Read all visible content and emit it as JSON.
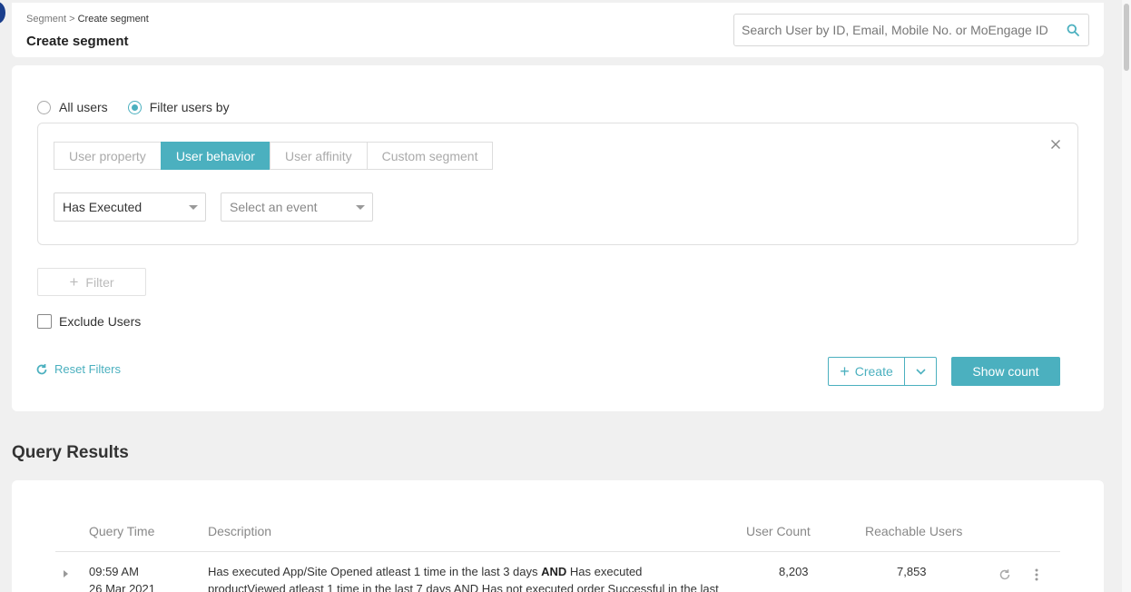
{
  "header": {
    "breadcrumb_root": "Segment",
    "breadcrumb_sep": ">",
    "breadcrumb_current": "Create segment",
    "title": "Create segment",
    "search_placeholder": "Search User by ID, Email, Mobile No. or MoEngage ID"
  },
  "audience": {
    "all_users_label": "All users",
    "filter_users_label": "Filter users by",
    "selected": "filter_users"
  },
  "filter": {
    "tabs": [
      "User property",
      "User behavior",
      "User affinity",
      "Custom segment"
    ],
    "active_tab": "User behavior",
    "condition_value": "Has Executed",
    "event_placeholder": "Select an event"
  },
  "actions": {
    "add_filter_label": "Filter",
    "exclude_users_label": "Exclude Users",
    "reset_filters_label": "Reset Filters",
    "create_label": "Create",
    "show_count_label": "Show count"
  },
  "results": {
    "section_title": "Query Results",
    "columns": {
      "query_time": "Query Time",
      "description": "Description",
      "user_count": "User Count",
      "reachable_users": "Reachable Users"
    },
    "rows": [
      {
        "time": "09:59 AM",
        "date_partial": "26 Mar 2021",
        "desc_part1": "Has executed App/Site Opened atleast 1 time in the last 3 days ",
        "desc_and": "AND",
        "desc_part2": " Has executed",
        "desc_line2": "productViewed atleast 1 time in the last 7 days AND Has not executed order Successful in the last",
        "user_count": "8,203",
        "reachable_users": "7,853"
      }
    ]
  },
  "colors": {
    "accent": "#4bb0bf",
    "background": "#f0f0f0"
  }
}
